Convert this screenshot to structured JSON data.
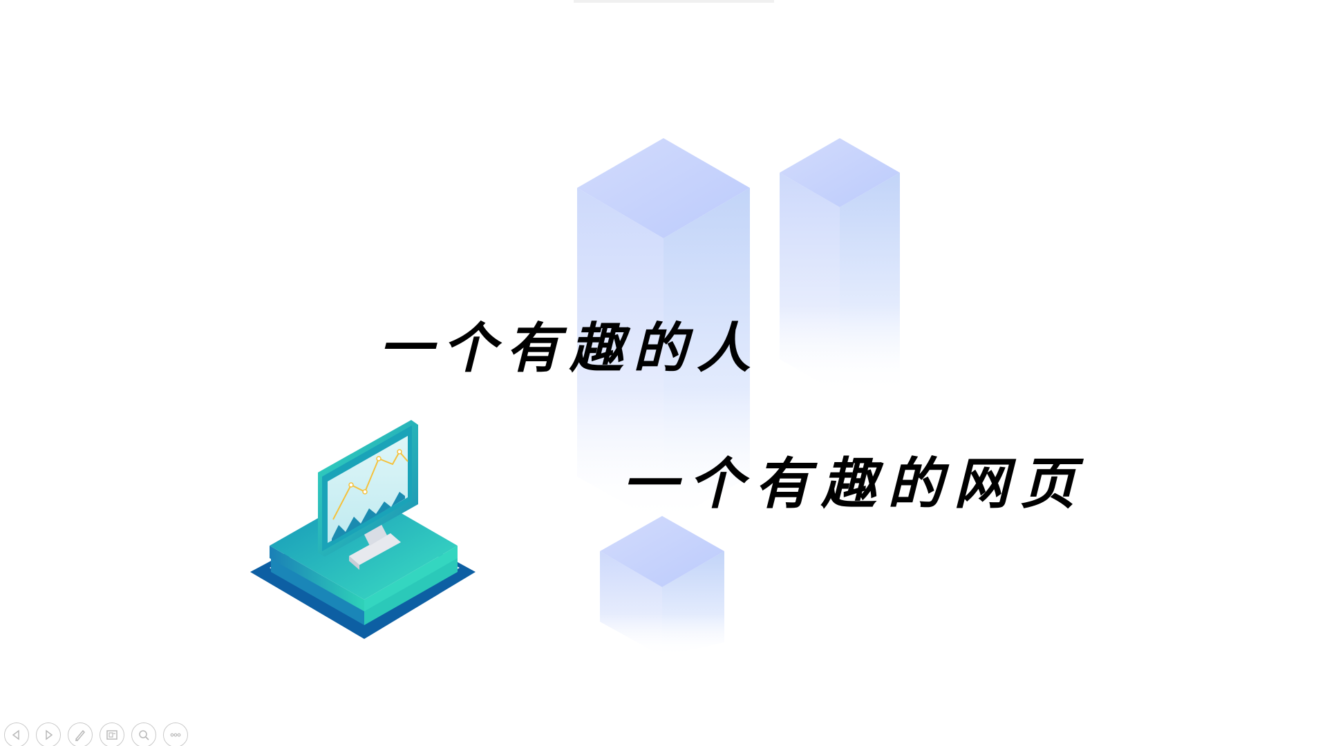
{
  "slide": {
    "line1": "一个有趣的人",
    "line2": "一个有趣的网页"
  },
  "toolbar": {
    "buttons": [
      {
        "name": "previous-slide",
        "icon": "chevron-left-icon"
      },
      {
        "name": "next-slide",
        "icon": "chevron-right-icon"
      },
      {
        "name": "pen-tool",
        "icon": "pen-icon"
      },
      {
        "name": "slide-overview",
        "icon": "slides-icon"
      },
      {
        "name": "zoom",
        "icon": "magnifier-icon"
      },
      {
        "name": "more-options",
        "icon": "ellipsis-icon"
      }
    ]
  },
  "colors": {
    "block_light": "#c5d2fb",
    "block_fade": "#eef2fe",
    "monitor_teal": "#2ec7b4",
    "monitor_blue": "#1e6fb5",
    "chart_yellow": "#f5c13b",
    "text": "#000000",
    "toolbar_stroke": "#c8c8c8"
  }
}
